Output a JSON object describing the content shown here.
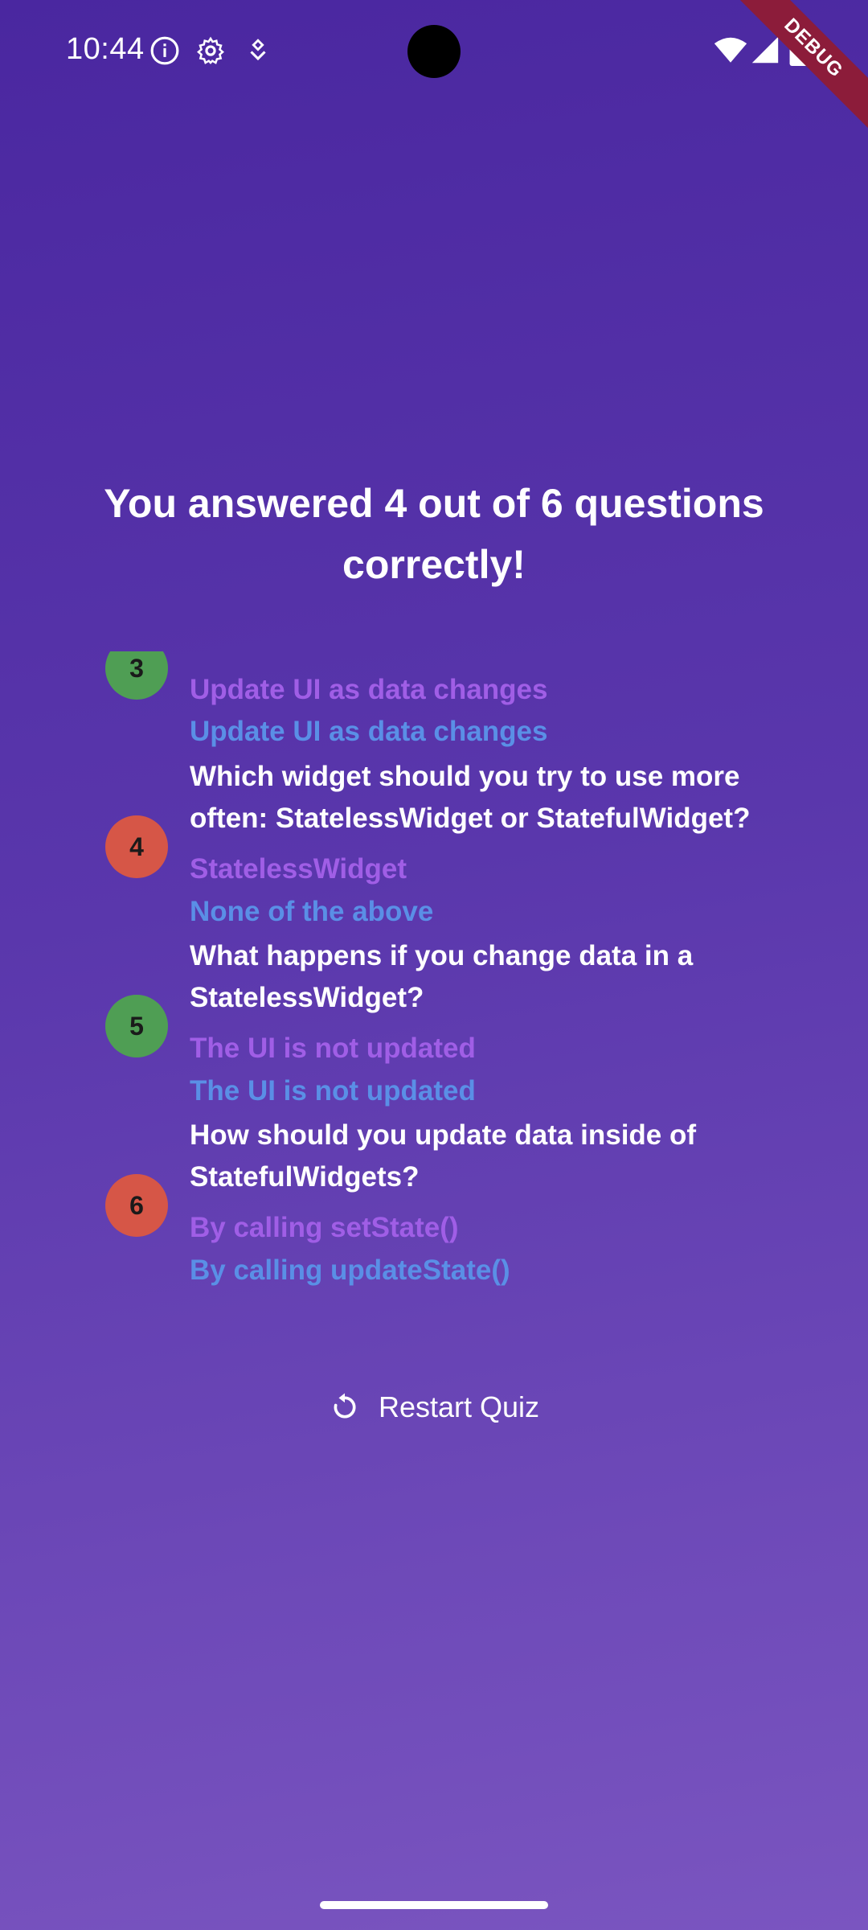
{
  "status_bar": {
    "time": "10:44",
    "icons": [
      "info-icon",
      "gear-icon",
      "location-icon",
      "wifi-icon",
      "signal-icon",
      "battery-icon"
    ],
    "debug_label": "DEBUG"
  },
  "result": {
    "title": "You answered 4 out of 6 questions correctly!"
  },
  "summary": [
    {
      "number": "3",
      "status": "correct",
      "question": "",
      "user_answer": "Update UI as data changes",
      "correct_answer": "Update UI as data changes"
    },
    {
      "number": "4",
      "status": "wrong",
      "question": "Which widget should you try to use more often: StatelessWidget or StatefulWidget?",
      "user_answer": "StatelessWidget",
      "correct_answer": "None of the above"
    },
    {
      "number": "5",
      "status": "correct",
      "question": "What happens if you change data in a StatelessWidget?",
      "user_answer": "The UI is not updated",
      "correct_answer": "The UI is not updated"
    },
    {
      "number": "6",
      "status": "wrong",
      "question": "How should you update data inside of StatefulWidgets?",
      "user_answer": "By calling setState()",
      "correct_answer": "By calling updateState()"
    }
  ],
  "restart": {
    "label": "Restart Quiz",
    "icon": "restart-icon"
  },
  "colors": {
    "correct_badge": "#4f9e54",
    "wrong_badge": "#d65647",
    "user_answer": "#a05ee6",
    "correct_answer": "#5a8fe6"
  }
}
